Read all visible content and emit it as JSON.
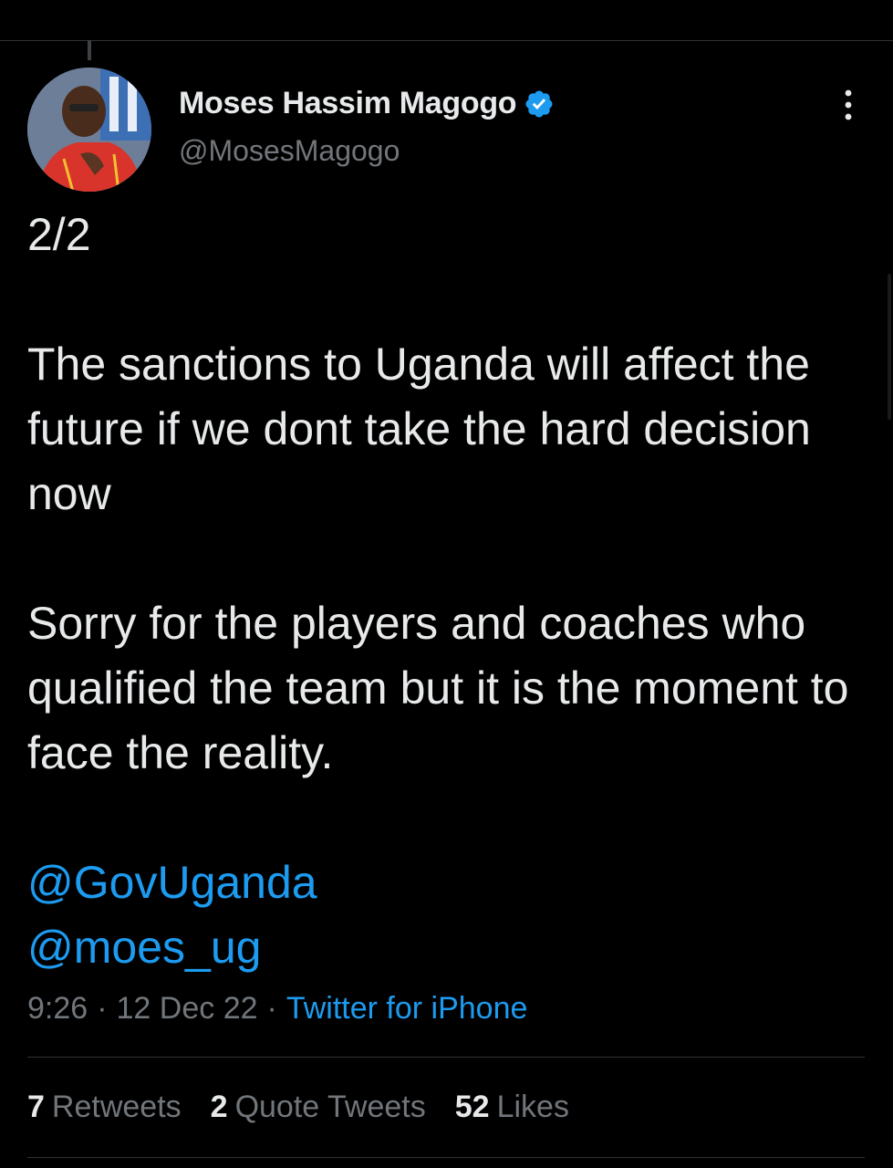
{
  "user": {
    "display_name": "Moses Hassim Magogo",
    "handle": "@MosesMagogo",
    "verified": true
  },
  "tweet": {
    "text": "2/2\n\nThe sanctions to Uganda will affect the future if we dont take the hard decision now\n\nSorry for the players and coaches who qualified the team but it is the moment to face the reality.",
    "mentions": [
      "@GovUganda",
      "@moes_ug"
    ],
    "time": "9:26",
    "date": "12 Dec 22",
    "separator": "·",
    "source": "Twitter for iPhone"
  },
  "stats": {
    "retweets": {
      "count": "7",
      "label": "Retweets"
    },
    "quotes": {
      "count": "2",
      "label": "Quote Tweets"
    },
    "likes": {
      "count": "52",
      "label": "Likes"
    }
  },
  "colors": {
    "background": "#000000",
    "text": "#e7e9ea",
    "secondary": "#71767b",
    "accent": "#1d9bf0"
  },
  "icons": {
    "verified": "verified-badge-icon",
    "more": "more-vertical-icon"
  }
}
